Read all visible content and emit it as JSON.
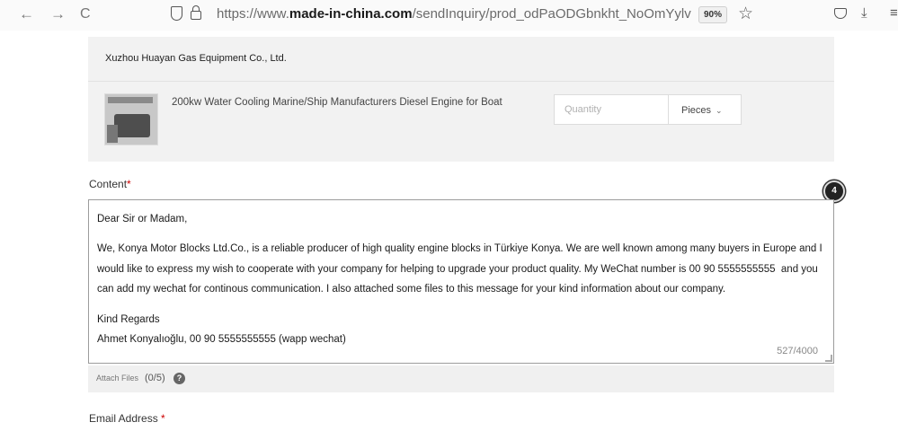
{
  "browser": {
    "url_prefix": "https://www.",
    "url_domain": "made-in-china.com",
    "url_path": "/sendInquiry/prod_odPaODGbnkht_NoOmYylvpBcs.ht",
    "zoom": "90%"
  },
  "icons": {
    "back": "←",
    "forward": "→",
    "reload": "C",
    "star": "☆",
    "download": "⤓",
    "menu": "≡"
  },
  "product_panel": {
    "supplier": "Xuzhou Huayan Gas Equipment Co., Ltd.",
    "product_title": "200kw Water Cooling Marine/Ship Manufacturers Diesel Engine for Boat",
    "quantity_placeholder": "Quantity",
    "unit_selected": "Pieces",
    "unit_chevron": "⌄"
  },
  "content": {
    "label": "Content",
    "required_mark": "*",
    "badge": "4",
    "message": {
      "greeting": "Dear Sir or Madam,",
      "body": "We, Konya Motor Blocks Ltd.Co., is a reliable producer of high quality engine blocks in Türkiye Konya. We are well known among many buyers in Europe and I would like to express my wish to cooperate with your company for helping to upgrade your product quality. My WeChat number is 00 90 5555555555  and you can add my wechat for continous communication. I also attached some files to this message for your kind information about our company.",
      "closing": "Kind Regards",
      "signature": "Ahmet Konyalıoğlu, 00 90 5555555555 (wapp wechat)"
    },
    "counter": "527/4000"
  },
  "attach": {
    "label": "Attach Files",
    "count": "(0/5)",
    "help": "?"
  },
  "email": {
    "label": "Email Address",
    "required_mark": "*"
  }
}
